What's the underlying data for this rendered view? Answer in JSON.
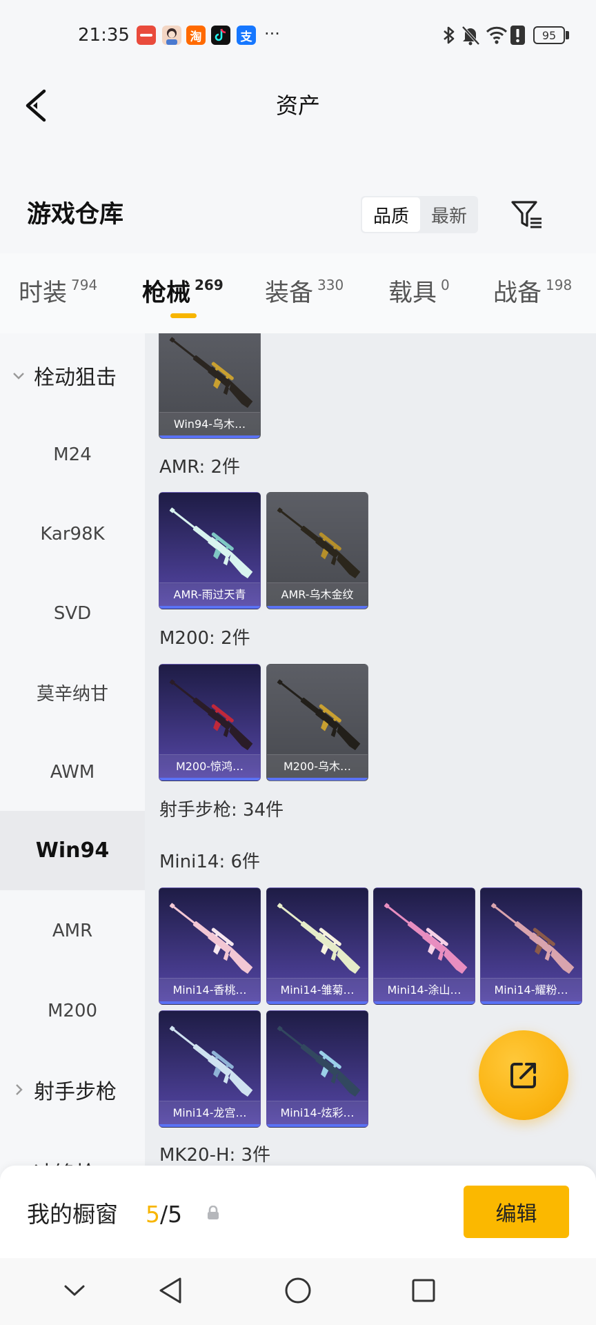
{
  "status_bar": {
    "time": "21:35",
    "app_icons": [
      {
        "icon": "huawei-mall-icon",
        "color": "#e94b3c"
      },
      {
        "icon": "game-avatar-icon",
        "color": "#f3d6c4"
      },
      {
        "icon": "taobao-icon",
        "color": "#ff6a00",
        "glyph": "淘"
      },
      {
        "icon": "tiktok-icon",
        "color": "#111111"
      },
      {
        "icon": "alipay-icon",
        "color": "#1677ff",
        "glyph": "支"
      }
    ],
    "more": "···",
    "system_icons": [
      "bluetooth-icon",
      "bell-off-icon",
      "wifi-icon",
      "alert-icon",
      "battery-icon"
    ],
    "battery": "95"
  },
  "header": {
    "title": "资产",
    "back_icon": "chevron-left-icon"
  },
  "warehouse": {
    "title": "游戏仓库",
    "sort_options": [
      "品质",
      "最新"
    ],
    "selected_sort_index": 0,
    "filter_icon": "filter-icon"
  },
  "tabs": [
    {
      "label": "时装",
      "count": "794",
      "active": false
    },
    {
      "label": "枪械",
      "count": "269",
      "active": true
    },
    {
      "label": "装备",
      "count": "330",
      "active": false
    },
    {
      "label": "载具",
      "count": "0",
      "active": false
    },
    {
      "label": "战备",
      "count": "198",
      "active": false
    }
  ],
  "sidebar": {
    "items": [
      {
        "label": "栓动狙击",
        "is_group": true,
        "expanded": true
      },
      {
        "label": "M24"
      },
      {
        "label": "Kar98K"
      },
      {
        "label": "SVD"
      },
      {
        "label": "莫辛纳甘"
      },
      {
        "label": "AWM"
      },
      {
        "label": "Win94",
        "selected": true
      },
      {
        "label": "AMR"
      },
      {
        "label": "M200"
      },
      {
        "label": "射手步枪",
        "is_group": true,
        "expanded": false
      },
      {
        "label": "冲锋枪",
        "is_group": true,
        "expanded": false
      }
    ]
  },
  "content": {
    "partial_card": {
      "label": "Win94-乌木…",
      "bg_top": "#5c5e65",
      "bg_bottom": "#47494f",
      "gun_color": "#2a2520",
      "gun_accent": "#c9a030"
    },
    "groups": [
      {
        "label": "AMR: 2件",
        "cards": [
          {
            "label": "AMR-雨过天青",
            "bg_top": "#1e1c45",
            "bg_bottom": "#5647a8",
            "gun_color": "#d8f3ef",
            "gun_accent": "#7fc8c4"
          },
          {
            "label": "AMR-乌木金纹",
            "bg_top": "#5c5e65",
            "bg_bottom": "#47494f",
            "gun_color": "#2b261c",
            "gun_accent": "#b58f2a"
          }
        ]
      },
      {
        "label": "M200: 2件",
        "cards": [
          {
            "label": "M200-惊鸿…",
            "bg_top": "#1e1c45",
            "bg_bottom": "#5647a8",
            "gun_color": "#2a1c28",
            "gun_accent": "#c0283a"
          },
          {
            "label": "M200-乌木…",
            "bg_top": "#5c5e65",
            "bg_bottom": "#47494f",
            "gun_color": "#221f1a",
            "gun_accent": "#c9a030"
          }
        ]
      },
      {
        "label": "射手步枪: 34件",
        "cards": []
      },
      {
        "label": "Mini14: 6件",
        "cards": [
          {
            "label": "Mini14-香桃…",
            "bg_top": "#1e1c45",
            "bg_bottom": "#5647a8",
            "gun_color": "#f3c7d4",
            "gun_accent": "#f7e7ee"
          },
          {
            "label": "Mini14-雏菊…",
            "bg_top": "#1e1c45",
            "bg_bottom": "#5647a8",
            "gun_color": "#e6ecc9",
            "gun_accent": "#f7f3e0"
          },
          {
            "label": "Mini14-涂山…",
            "bg_top": "#1e1c45",
            "bg_bottom": "#5647a8",
            "gun_color": "#e88ec0",
            "gun_accent": "#f6d1e6"
          },
          {
            "label": "Mini14-耀粉…",
            "bg_top": "#1e1c45",
            "bg_bottom": "#5647a8",
            "gun_color": "#d9a4ae",
            "gun_accent": "#8a5a4a"
          },
          {
            "label": "Mini14-龙宫…",
            "bg_top": "#1e1c45",
            "bg_bottom": "#5647a8",
            "gun_color": "#cfe2f0",
            "gun_accent": "#8fb3d6"
          },
          {
            "label": "Mini14-炫彩…",
            "bg_top": "#1e1c45",
            "bg_bottom": "#5647a8",
            "gun_color": "#32485f",
            "gun_accent": "#9ad0e8"
          }
        ]
      },
      {
        "label": "MK20-H: 3件",
        "cards": []
      }
    ]
  },
  "fab": {
    "icon": "share-icon"
  },
  "showcase": {
    "title": "我的橱窗",
    "count": "5",
    "separator": "/",
    "total": "5",
    "lock_icon": "lock-icon",
    "edit_label": "编辑"
  },
  "nav_bar": {
    "icons": [
      "chevron-down-icon",
      "back-icon",
      "home-icon",
      "recents-icon"
    ]
  },
  "colors": {
    "accent": "#f7b500",
    "card_underline": "#5a72f5",
    "edit_button": "#fbb800",
    "selected_sidebar_bg": "#e9eaed"
  }
}
